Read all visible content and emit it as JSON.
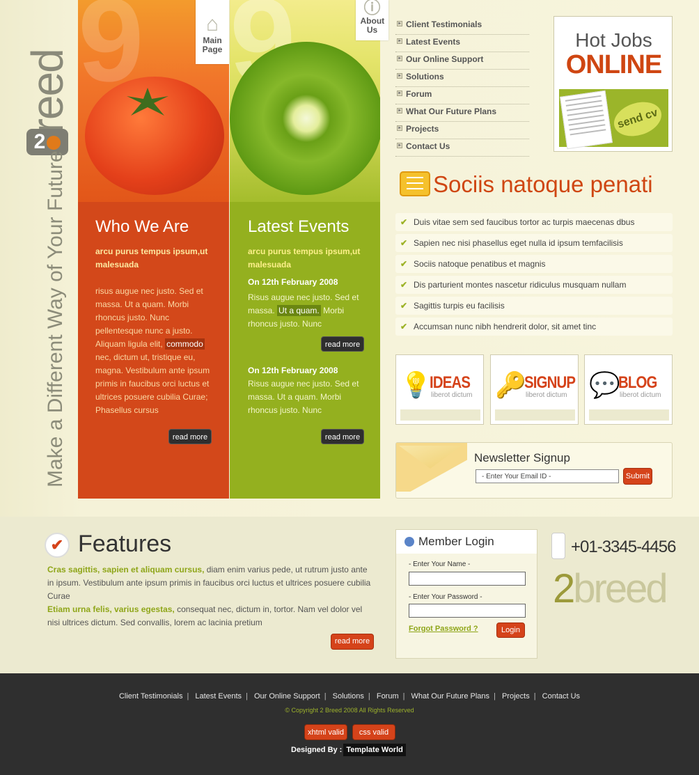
{
  "brand": {
    "logo_word": "breed",
    "logo_badge": "2",
    "tagline": "Make a Different Way of Your Future"
  },
  "top_tabs": {
    "main_page": "Main Page",
    "about_us": "About Us"
  },
  "nav": [
    "Client Testimonials",
    "Latest Events",
    "Our Online Support",
    "Solutions",
    "Forum",
    "What Our Future Plans",
    "Projects",
    "Contact Us"
  ],
  "hot_jobs": {
    "line1": "Hot Jobs",
    "line2": "ONLINE",
    "badge": "send cv"
  },
  "who_we_are": {
    "title": "Who We Are",
    "subtitle": "arcu purus tempus ipsum,ut malesuada",
    "text_before": "risus augue nec justo. Sed et massa. Ut a quam. Morbi rhoncus justo. Nunc pellentesque nunc a justo. Aliquam ligula elit,",
    "highlight": "commodo",
    "text_after": "nec, dictum ut, tristique eu, magna. Vestibulum ante ipsum primis in faucibus orci luctus et ultrices posuere cubilia Curae; Phasellus cursus",
    "read_more": "read more"
  },
  "latest_events": {
    "title": "Latest Events",
    "subtitle": "arcu purus tempus ipsum,ut malesuada",
    "event1": {
      "date": "On 12th February 2008",
      "text_before": "Risus augue nec justo. Sed et massa.",
      "highlight": "Ut a quam.",
      "text_after": "Morbi rhoncus justo. Nunc",
      "read_more": "read more"
    },
    "event2": {
      "date": "On 12th February 2008",
      "text": "Risus augue nec justo. Sed et massa. Ut a quam. Morbi rhoncus justo. Nunc",
      "read_more": "read more"
    }
  },
  "section": {
    "title": "Sociis natoque penati",
    "checks": [
      "Duis vitae sem sed faucibus tortor ac turpis maecenas dbus",
      "Sapien nec nisi phasellus eget nulla id ipsum temfacilisis",
      "Sociis natoque penatibus et magnis",
      "Dis parturient montes nascetur ridiculus musquam nullam",
      "Sagittis turpis eu facilisis",
      "Accumsan nunc nibh hendrerit dolor, sit amet tinc"
    ]
  },
  "boxes": [
    {
      "title": "IDEAS",
      "sub": "liberot dictum",
      "color": "#d5431a",
      "icon": "lightbulb-icon"
    },
    {
      "title": "SIGNUP",
      "sub": "liberot dictum",
      "color": "#d5431a",
      "icon": "key-user-icon"
    },
    {
      "title": "BLOG",
      "sub": "liberot dictum",
      "color": "#d5431a",
      "icon": "speech-bubble-icon"
    }
  ],
  "newsletter": {
    "title": "Newsletter Signup",
    "placeholder": "- Enter Your Email ID -",
    "submit": "Submit"
  },
  "features": {
    "title": "Features",
    "lead1": "Cras sagittis, sapien et aliquam cursus,",
    "text1": "diam enim varius pede, ut rutrum justo ante in ipsum. Vestibulum ante ipsum primis in faucibus orci luctus et ultrices posuere cubilia Curae",
    "lead2": "Etiam urna felis, varius egestas,",
    "text2": "consequat nec, dictum in, tortor. Nam vel dolor vel nisi ultrices dictum. Sed convallis, lorem ac lacinia pretium",
    "read_more": "read more"
  },
  "login": {
    "title": "Member Login",
    "name_label": "- Enter Your Name -",
    "password_label": "- Enter Your Password -",
    "forgot": "Forgot Password ?",
    "button": "Login"
  },
  "contact": {
    "phone": "+01-3345-4456",
    "logo_num": "2",
    "logo_word": "breed"
  },
  "footer": {
    "links": [
      "Client Testimonials",
      "Latest Events",
      "Our Online Support",
      "Solutions",
      "Forum",
      "What Our Future Plans",
      "Projects",
      "Contact Us"
    ],
    "copyright": "© Copyright 2 Breed 2008 All Rights Reserved",
    "xhtml": "xhtml valid",
    "css": "css valid",
    "designed_by": "Designed By :",
    "designer": "Template World"
  },
  "colors": {
    "accent_orange": "#d5431a",
    "accent_green": "#94b01f"
  }
}
